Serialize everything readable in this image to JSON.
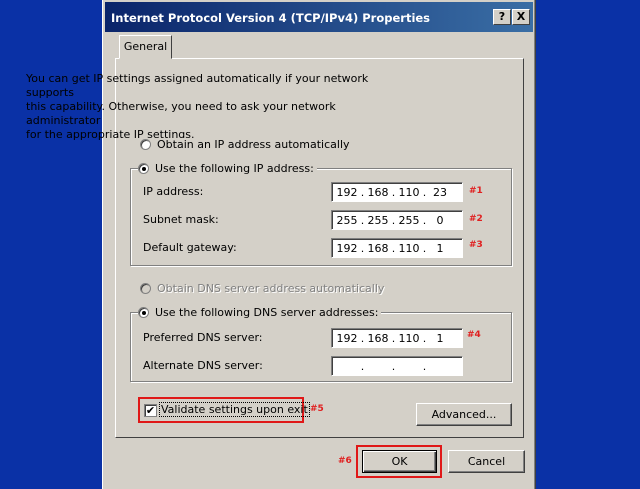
{
  "window": {
    "title": "Internet Protocol Version 4 (TCP/IPv4) Properties",
    "help_btn": "?",
    "close_btn": "X"
  },
  "tabs": [
    {
      "label": "General"
    }
  ],
  "description": "You can get IP settings assigned automatically if your network supports\nthis capability. Otherwise, you need to ask your network administrator\nfor the appropriate IP settings.",
  "ip_section": {
    "auto_label": "Obtain an IP address automatically",
    "manual_label": "Use the following IP address:",
    "selected": "manual",
    "fields": [
      {
        "label": "IP address:",
        "octets": [
          "192",
          "168",
          "110",
          "23"
        ],
        "marker": "#1"
      },
      {
        "label": "Subnet mask:",
        "octets": [
          "255",
          "255",
          "255",
          "0"
        ],
        "marker": "#2"
      },
      {
        "label": "Default gateway:",
        "octets": [
          "192",
          "168",
          "110",
          "1"
        ],
        "marker": "#3"
      }
    ]
  },
  "dns_section": {
    "auto_label": "Obtain DNS server address automatically",
    "manual_label": "Use the following DNS server addresses:",
    "selected": "manual",
    "auto_disabled": true,
    "fields": [
      {
        "label": "Preferred DNS server:",
        "octets": [
          "192",
          "168",
          "110",
          "1"
        ],
        "marker": "#4"
      },
      {
        "label": "Alternate DNS server:",
        "octets": [
          "",
          "",
          "",
          ""
        ],
        "marker": ""
      }
    ]
  },
  "validate": {
    "label": "Validate settings upon exit",
    "checked": true,
    "marker": "#5"
  },
  "buttons": {
    "advanced": "Advanced...",
    "ok": "OK",
    "cancel": "Cancel",
    "ok_marker": "#6"
  },
  "colors": {
    "background": "#0a2fa8",
    "highlight": "#e01818",
    "titlebar": "#0a246a"
  }
}
